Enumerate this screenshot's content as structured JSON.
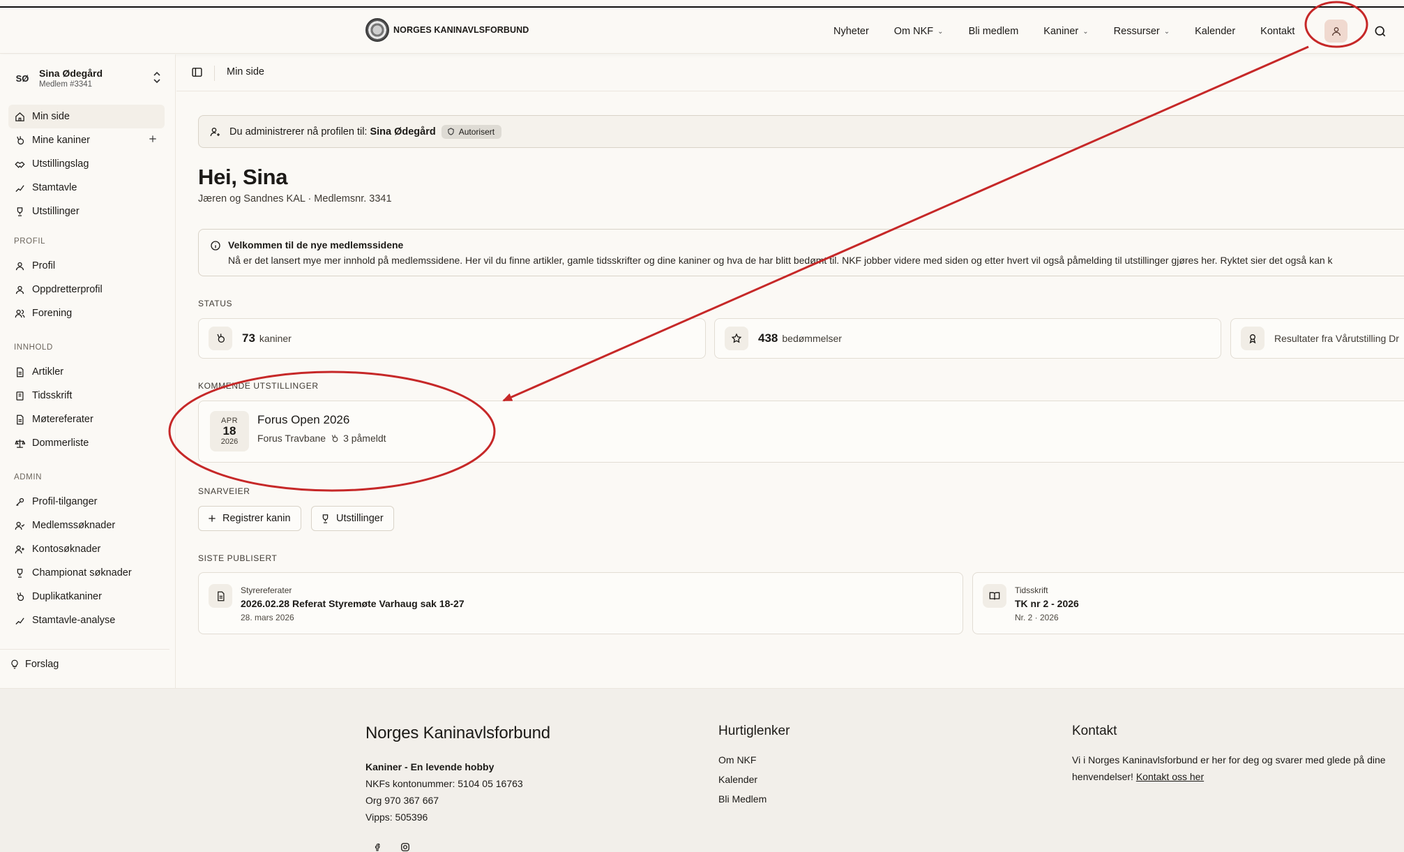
{
  "header": {
    "logo_text": "NORGES KANINAVLSFORBUND",
    "nav": [
      {
        "label": "Nyheter",
        "dropdown": false
      },
      {
        "label": "Om NKF",
        "dropdown": true
      },
      {
        "label": "Bli medlem",
        "dropdown": false
      },
      {
        "label": "Kaniner",
        "dropdown": true
      },
      {
        "label": "Ressurser",
        "dropdown": true
      },
      {
        "label": "Kalender",
        "dropdown": false
      },
      {
        "label": "Kontakt",
        "dropdown": false
      }
    ],
    "icons": {
      "user": "user-icon",
      "search": "search-icon"
    }
  },
  "sidebar": {
    "user": {
      "initials": "SØ",
      "name": "Sina Ødegård",
      "member": "Medlem #3341"
    },
    "main_items": [
      {
        "label": "Min side",
        "icon": "home-icon"
      },
      {
        "label": "Mine kaniner",
        "icon": "rabbit-icon"
      },
      {
        "label": "Utstillingslag",
        "icon": "handshake-icon"
      },
      {
        "label": "Stamtavle",
        "icon": "tree-icon"
      },
      {
        "label": "Utstillinger",
        "icon": "trophy-icon"
      }
    ],
    "profil_label": "PROFIL",
    "profil_items": [
      {
        "label": "Profil",
        "icon": "user-icon"
      },
      {
        "label": "Oppdretterprofil",
        "icon": "user-icon"
      },
      {
        "label": "Forening",
        "icon": "users-icon"
      }
    ],
    "innhold_label": "INNHOLD",
    "innhold_items": [
      {
        "label": "Artikler",
        "icon": "document-icon"
      },
      {
        "label": "Tidsskrift",
        "icon": "book-icon"
      },
      {
        "label": "Møtereferater",
        "icon": "document-icon"
      },
      {
        "label": "Dommerliste",
        "icon": "scale-icon"
      }
    ],
    "admin_label": "ADMIN",
    "admin_items": [
      {
        "label": "Profil-tilganger",
        "icon": "key-icon"
      },
      {
        "label": "Medlemssøknader",
        "icon": "user-check-icon"
      },
      {
        "label": "Kontosøknader",
        "icon": "user-plus-icon"
      },
      {
        "label": "Championat søknader",
        "icon": "trophy-icon"
      },
      {
        "label": "Duplikatkaniner",
        "icon": "rabbit-icon"
      },
      {
        "label": "Stamtavle-analyse",
        "icon": "tree-icon"
      }
    ],
    "footer_item": "Forslag"
  },
  "main": {
    "breadcrumb": "Min side",
    "admin_banner": {
      "text": "Du administrerer nå profilen til:",
      "name": "Sina Ødegård",
      "badge": "Autorisert"
    },
    "greeting": "Hei, Sina",
    "greeting_sub": "Jæren og Sandnes KAL · Medlemsnr. 3341",
    "info": {
      "title": "Velkommen til de nye medlemssidene",
      "text": "Nå er det lansert mye mer innhold på medlemssidene. Her vil du finne artikler, gamle tidsskrifter og dine kaniner og hva de har blitt bedømt til. NKF jobber videre med siden og etter hvert vil også påmelding til utstillinger gjøres her. Ryktet sier det også kan k"
    },
    "status_label": "STATUS",
    "stats": [
      {
        "number": "73",
        "label": "kaniner",
        "icon": "rabbit-icon"
      },
      {
        "number": "438",
        "label": "bedømmelser",
        "icon": "star-icon"
      },
      {
        "number": "",
        "label": "Resultater fra Vårutstilling Dr",
        "icon": "award-icon"
      }
    ],
    "upcoming_label": "KOMMENDE UTSTILLINGER",
    "event": {
      "month": "APR",
      "day": "18",
      "year": "2026",
      "title": "Forus Open 2026",
      "location": "Forus Travbane",
      "registered": "3 påmeldt"
    },
    "shortcuts_label": "SNARVEIER",
    "shortcuts": [
      {
        "label": "Registrer kanin",
        "icon": "plus-icon"
      },
      {
        "label": "Utstillinger",
        "icon": "trophy-icon"
      }
    ],
    "published_label": "SISTE PUBLISERT",
    "published": [
      {
        "category": "Styrereferater",
        "title": "2026.02.28 Referat Styremøte Varhaug sak 18-27",
        "date": "28. mars 2026",
        "icon": "document-icon"
      },
      {
        "category": "Tidsskrift",
        "title": "TK nr 2 - 2026",
        "date": "Nr. 2 · 2026",
        "icon": "book-icon"
      }
    ]
  },
  "footer": {
    "org_title": "Norges Kaninavlsforbund",
    "tagline": "Kaniner - En levende hobby",
    "lines": [
      "NKFs kontonummer: 5104 05 16763",
      "Org 970 367 667",
      "Vipps: 505396"
    ],
    "quick_title": "Hurtiglenker",
    "quick_links": [
      "Om NKF",
      "Kalender",
      "Bli Medlem"
    ],
    "contact_title": "Kontakt",
    "contact_text": "Vi i Norges Kaninavlsforbund er her for deg og svarer med glede på dine henvendelser!",
    "contact_link": "Kontakt oss her",
    "social_icons": [
      "facebook-icon",
      "instagram-icon"
    ]
  },
  "annotation_color": "#c62828"
}
